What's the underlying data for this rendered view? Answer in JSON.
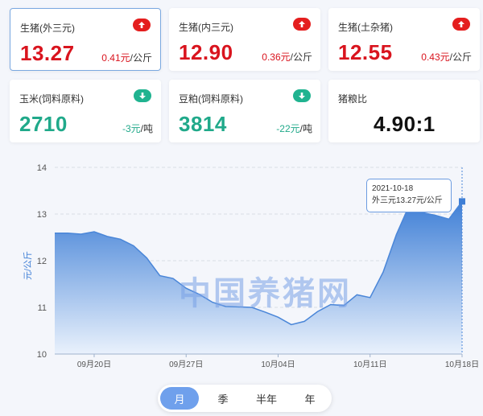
{
  "cards": [
    {
      "title": "生猪(外三元)",
      "price": "13.27",
      "change_amount": "0.41元",
      "unit": "/公斤",
      "trend": "up"
    },
    {
      "title": "生猪(内三元)",
      "price": "12.90",
      "change_amount": "0.36元",
      "unit": "/公斤",
      "trend": "up"
    },
    {
      "title": "生猪(土杂猪)",
      "price": "12.55",
      "change_amount": "0.43元",
      "unit": "/公斤",
      "trend": "up"
    },
    {
      "title": "玉米(饲料原料)",
      "price": "2710",
      "change_amount": "-3元",
      "unit": "/吨",
      "trend": "down"
    },
    {
      "title": "豆粕(饲料原料)",
      "price": "3814",
      "change_amount": "-22元",
      "unit": "/吨",
      "trend": "down"
    },
    {
      "title": "猪粮比",
      "price": "4.90:1",
      "change_amount": "",
      "unit": "",
      "trend": "none"
    }
  ],
  "colors": {
    "up": "#d9141e",
    "down": "#20a98a",
    "accent": "#3f7fd6"
  },
  "watermark": "中国养猪网",
  "tooltip": {
    "date": "2021-10-18",
    "label": "外三元13.27元/公斤"
  },
  "tabs": [
    "月",
    "季",
    "半年",
    "年"
  ],
  "active_tab": "月",
  "chart_data": {
    "type": "area",
    "ylabel": "元/公斤",
    "ylim": [
      10,
      14
    ],
    "yticks": [
      10,
      11,
      12,
      13,
      14
    ],
    "xtick_labels": [
      "09月20日",
      "09月27日",
      "10月04日",
      "10月11日",
      "10月18日"
    ],
    "series": [
      {
        "x": [
          "09-17",
          "09-18",
          "09-19",
          "09-20",
          "09-21",
          "09-22",
          "09-23",
          "09-24",
          "09-25",
          "09-26",
          "09-27",
          "09-28",
          "09-29",
          "09-30",
          "10-01",
          "10-02",
          "10-03",
          "10-04",
          "10-05",
          "10-06",
          "10-07",
          "10-08",
          "10-09",
          "10-10",
          "10-11",
          "10-12",
          "10-13",
          "10-14",
          "10-15",
          "10-16",
          "10-17",
          "10-18"
        ],
        "values": [
          12.59,
          12.59,
          12.57,
          12.62,
          12.52,
          12.46,
          12.32,
          12.06,
          11.68,
          11.62,
          11.41,
          11.28,
          11.11,
          11.02,
          11.01,
          11.0,
          10.9,
          10.79,
          10.63,
          10.7,
          10.91,
          11.06,
          11.04,
          11.27,
          11.21,
          11.76,
          12.56,
          13.2,
          13.03,
          12.97,
          12.89,
          13.27
        ]
      }
    ],
    "grid": true
  }
}
